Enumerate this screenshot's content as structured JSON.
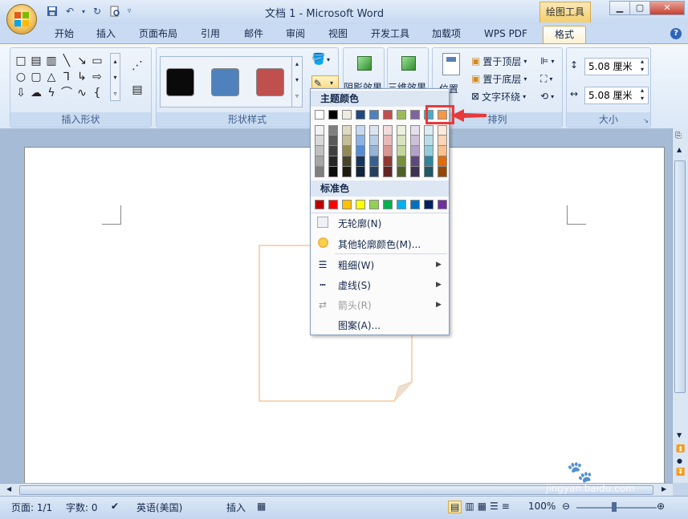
{
  "window": {
    "title": "文档 1 - Microsoft Word",
    "context_tab": "绘图工具"
  },
  "tabs": [
    "开始",
    "插入",
    "页面布局",
    "引用",
    "邮件",
    "审阅",
    "视图",
    "开发工具",
    "加载项",
    "WPS PDF",
    "格式"
  ],
  "active_tab": "格式",
  "ribbon": {
    "group_insert_shapes": "插入形状",
    "group_shape_styles": "形状样式",
    "shadow_effects": "阴影效果",
    "three_d_effects": "三维效果",
    "position_label": "位置",
    "group_arrange": "排列",
    "bring_to_front": "置于顶层",
    "send_to_back": "置于底层",
    "text_wrap": "文字环绕",
    "group_size": "大小",
    "height_value": "5.08 厘米",
    "width_value": "5.08 厘米",
    "style_colors": [
      "#0a0a0a",
      "#4f81bd",
      "#c0504d"
    ]
  },
  "dropdown": {
    "theme_colors_title": "主题颜色",
    "standard_colors_title": "标准色",
    "theme_top": [
      "#ffffff",
      "#000000",
      "#eeece1",
      "#1f497d",
      "#4f81bd",
      "#c0504d",
      "#9bbb59",
      "#8064a2",
      "#4bacc6",
      "#f79646"
    ],
    "theme_shades": [
      [
        "#f2f2f2",
        "#7f7f7f",
        "#ddd9c3",
        "#c6d9f0",
        "#dbe5f1",
        "#f2dcdb",
        "#ebf1dd",
        "#e5e0ec",
        "#dbeef3",
        "#fdeada"
      ],
      [
        "#d8d8d8",
        "#595959",
        "#c4bd97",
        "#8db3e2",
        "#b8cce4",
        "#e5b9b7",
        "#d7e3bc",
        "#ccc1d9",
        "#b7dde8",
        "#fbd5b5"
      ],
      [
        "#bfbfbf",
        "#3f3f3f",
        "#938953",
        "#548dd4",
        "#95b3d7",
        "#d99694",
        "#c3d69b",
        "#b2a2c7",
        "#92cddc",
        "#fac08f"
      ],
      [
        "#a5a5a5",
        "#262626",
        "#494429",
        "#17365d",
        "#366092",
        "#953734",
        "#76923c",
        "#5f497a",
        "#31859b",
        "#e36c09"
      ],
      [
        "#7f7f7f",
        "#0c0c0c",
        "#1d1b10",
        "#0f243e",
        "#244061",
        "#632423",
        "#4f6128",
        "#3f3151",
        "#205867",
        "#974806"
      ]
    ],
    "standard": [
      "#c00000",
      "#ff0000",
      "#ffc000",
      "#ffff00",
      "#92d050",
      "#00b050",
      "#00b0f0",
      "#0070c0",
      "#002060",
      "#7030a0"
    ],
    "items": {
      "no_outline": "无轮廓(N)",
      "more_colors": "其他轮廓颜色(M)...",
      "weight": "粗细(W)",
      "dashes": "虚线(S)",
      "arrows": "箭头(R)",
      "pattern": "图案(A)..."
    }
  },
  "status": {
    "page": "页面: 1/1",
    "words": "字数: 0",
    "language": "英语(美国)",
    "mode": "插入",
    "zoom": "100%"
  },
  "watermark": "jingyan.baidu.com",
  "colors": {
    "highlight_red": "#e8393a",
    "shape_outline": "#f9c79b"
  }
}
